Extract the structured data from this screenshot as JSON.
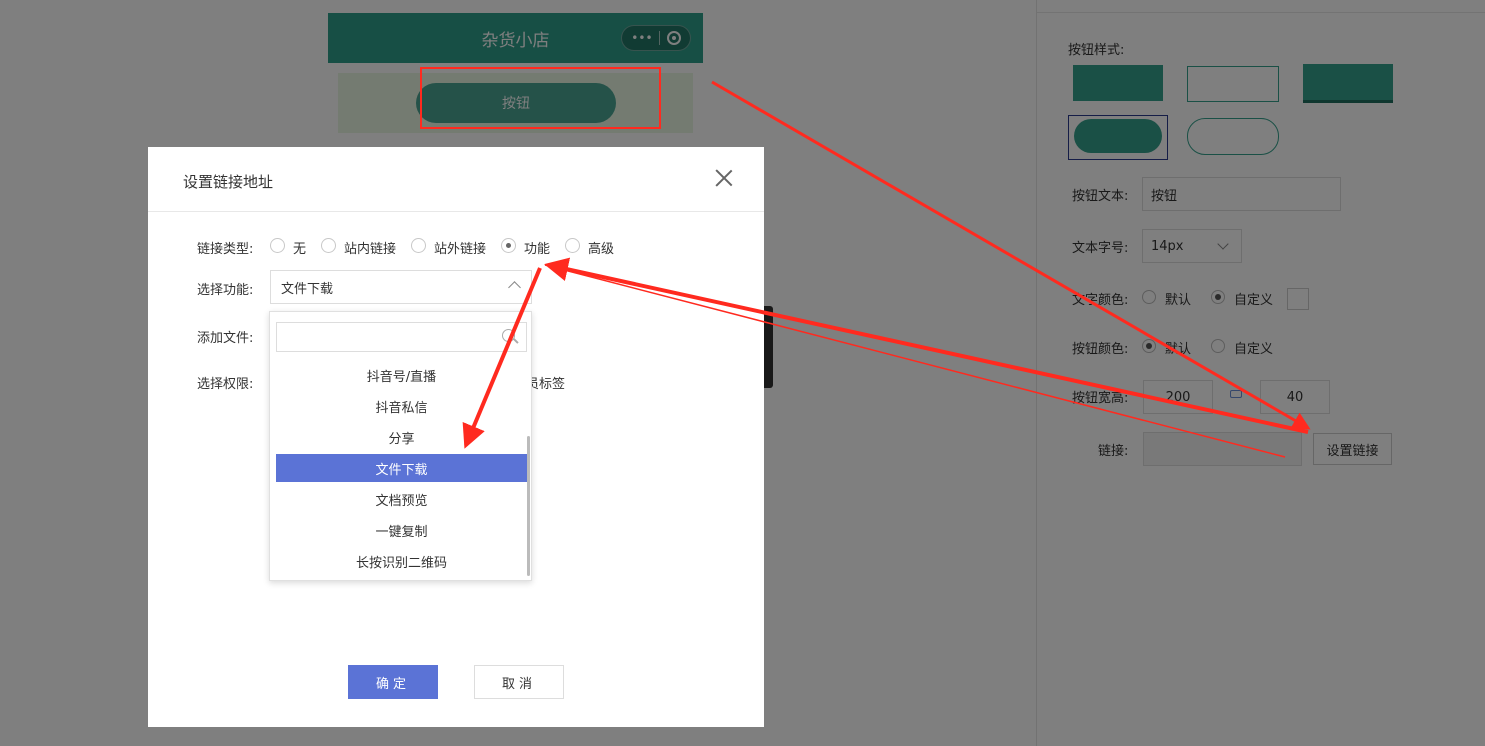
{
  "phone": {
    "title": "杂货小店",
    "capsule_more": "•••",
    "button_text": "按钮"
  },
  "right_panel": {
    "button_style_label": "按钮样式:",
    "button_text_label": "按钮文本:",
    "button_text_value": "按钮",
    "font_size_label": "文本字号:",
    "font_size_value": "14px",
    "text_color_label": "文字颜色:",
    "button_color_label": "按钮颜色:",
    "default_label": "默认",
    "custom_label": "自定义",
    "size_label": "按钮宽高:",
    "width_value": "200",
    "height_value": "40",
    "link_label": "链接:",
    "set_link_button": "设置链接"
  },
  "modal": {
    "title": "设置链接地址",
    "link_type_label": "链接类型:",
    "link_types": [
      "无",
      "站内链接",
      "站外链接",
      "功能",
      "高级"
    ],
    "selected_link_type": "功能",
    "select_function_label": "选择功能:",
    "selected_function": "文件下载",
    "add_file_label": "添加文件:",
    "permission_label": "选择权限:",
    "permission_partial_text": "员标签",
    "dropdown_items": [
      "抖音号/直播",
      "抖音私信",
      "分享",
      "文件下载",
      "文档预览",
      "一键复制",
      "长按识别二维码"
    ],
    "confirm": "确定",
    "cancel": "取消"
  },
  "colors": {
    "header": "#2e9e8a",
    "accent": "#5b73d6",
    "button_green": "#35a18c",
    "annotation_red": "#ff2a1f"
  }
}
